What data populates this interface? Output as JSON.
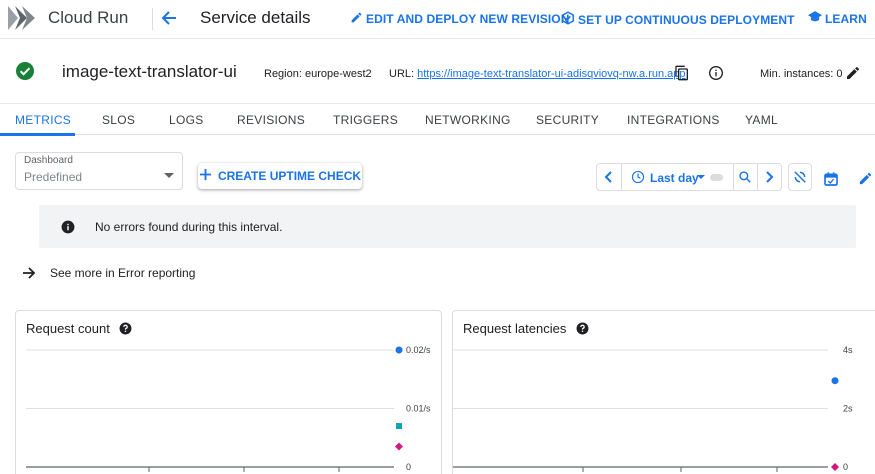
{
  "header": {
    "product_name": "Cloud Run",
    "page_title": "Service details",
    "actions": {
      "edit_deploy": "EDIT AND DEPLOY NEW REVISION",
      "continuous_deployment": "SET UP CONTINUOUS DEPLOYMENT",
      "learn": "LEARN"
    }
  },
  "service": {
    "name": "image-text-translator-ui",
    "region_text": "Region: europe-west2",
    "url_label": "URL:",
    "url": "https://image-text-translator-ui-adisqviovq-nw.a.run.app",
    "min_instances_text": "Min. instances: 0"
  },
  "tabs": [
    {
      "label": "METRICS",
      "active": true
    },
    {
      "label": "SLOS"
    },
    {
      "label": "LOGS"
    },
    {
      "label": "REVISIONS"
    },
    {
      "label": "TRIGGERS"
    },
    {
      "label": "NETWORKING"
    },
    {
      "label": "SECURITY"
    },
    {
      "label": "INTEGRATIONS"
    },
    {
      "label": "YAML"
    }
  ],
  "toolbar": {
    "dashboard_label": "Dashboard",
    "dashboard_value": "Predefined",
    "uptime_button": "CREATE UPTIME CHECK",
    "time_range": "Last day"
  },
  "errors": {
    "banner_text": "No errors found during this interval.",
    "see_more": "See more in Error reporting"
  },
  "colors": {
    "accent": "#1a73e8",
    "status_ok": "#188038",
    "series_blue": "#1a73e8",
    "series_teal": "#12a4af",
    "series_pink": "#d01884"
  },
  "chart_data": [
    {
      "type": "scatter",
      "title": "Request count",
      "y_tick_labels": [
        "0.02/s",
        "0.01/s",
        "0"
      ],
      "ylim": [
        0,
        0.02
      ],
      "grid": true,
      "series": [
        {
          "color": "#1a73e8",
          "marker": "circle",
          "values": [
            0.02
          ]
        },
        {
          "color": "#12a4af",
          "marker": "square",
          "values": [
            0.007
          ]
        },
        {
          "color": "#d01884",
          "marker": "diamond",
          "values": [
            0.0035
          ]
        }
      ]
    },
    {
      "type": "scatter",
      "title": "Request latencies",
      "y_tick_labels": [
        "4s",
        "2s",
        "0"
      ],
      "ylim": [
        0,
        4
      ],
      "grid": true,
      "series": [
        {
          "color": "#1a73e8",
          "marker": "circle",
          "values": [
            2.95
          ]
        },
        {
          "color": "#d01884",
          "marker": "diamond",
          "values": [
            0
          ]
        }
      ]
    }
  ]
}
